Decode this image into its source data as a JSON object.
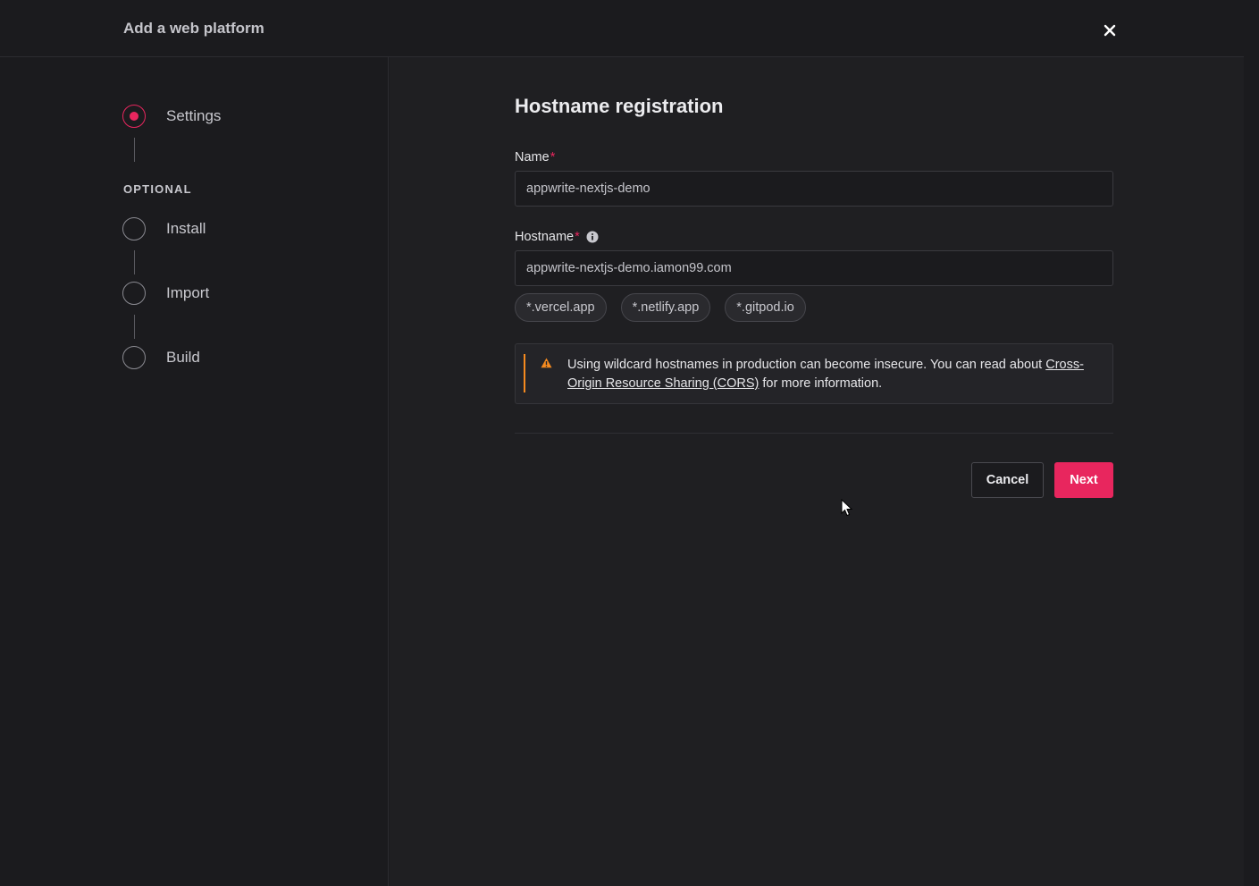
{
  "header": {
    "title": "Add a web platform",
    "close_icon": "close-icon"
  },
  "steps": {
    "settings": "Settings",
    "optional_label": "OPTIONAL",
    "install": "Install",
    "import": "Import",
    "build": "Build"
  },
  "form": {
    "title": "Hostname registration",
    "name_label": "Name",
    "name_value": "appwrite-nextjs-demo",
    "hostname_label": "Hostname",
    "hostname_value": "appwrite-nextjs-demo.iamon99.com",
    "required_mark": "*",
    "suggestions": [
      "*.vercel.app",
      "*.netlify.app",
      "*.gitpod.io"
    ]
  },
  "alert": {
    "text_before": "Using wildcard hostnames in production can become insecure. You can read about ",
    "link_text": "Cross-Origin Resource Sharing (CORS)",
    "text_after": " for more information."
  },
  "buttons": {
    "cancel": "Cancel",
    "next": "Next"
  },
  "colors": {
    "accent": "#e8265e",
    "warning": "#f58a1f",
    "background": "#1b1b1e"
  }
}
